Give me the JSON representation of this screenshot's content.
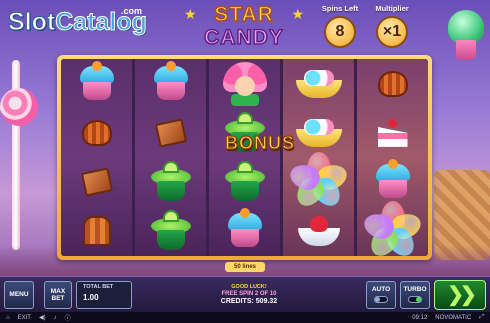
{
  "logo": {
    "word_slot": "Slot",
    "word_catalog": "Catalog",
    "suffix": ".com"
  },
  "title": {
    "line1": "STAR",
    "line2": "CANDY"
  },
  "counters": {
    "spins_left": {
      "label": "Spins Left",
      "value": "8"
    },
    "multiplier": {
      "label": "Multiplier",
      "value": "×1"
    }
  },
  "reels": [
    [
      "cupcake-blue",
      "choco-shell",
      "choco-square",
      "choco-bell"
    ],
    [
      "cupcake-blue",
      "choco-square",
      "cupcake-green",
      "cupcake-green"
    ],
    [
      "girl",
      "cupcake-green",
      "cupcake-green",
      "cupcake-blue"
    ],
    [
      "banana-split",
      "banana-split",
      "bonus",
      "strawberry-bowl"
    ],
    [
      "choco-shell",
      "cake-slice",
      "cupcake-blue",
      "bonus"
    ]
  ],
  "bonus_label": "BONUS",
  "lines_label": "50 lines",
  "controls": {
    "menu": "MENU",
    "max_bet": "MAX BET",
    "total_bet_label": "TOTAL BET",
    "total_bet_value": "1.00",
    "good_luck": "GOOD LUCK!",
    "free_spin": "FREE SPIN 2 OF 10",
    "credits": "CREDITS: 509.32",
    "auto": "AUTO",
    "turbo": "TURBO",
    "spin_glyph": "❯❯"
  },
  "info_strip": {
    "exit": "EXIT",
    "time": "09:12",
    "brand": "NOVOMATIC"
  },
  "colors": {
    "frame": "#f0a836",
    "spin": "#1f8a2e",
    "accent": "#ffd84a"
  }
}
